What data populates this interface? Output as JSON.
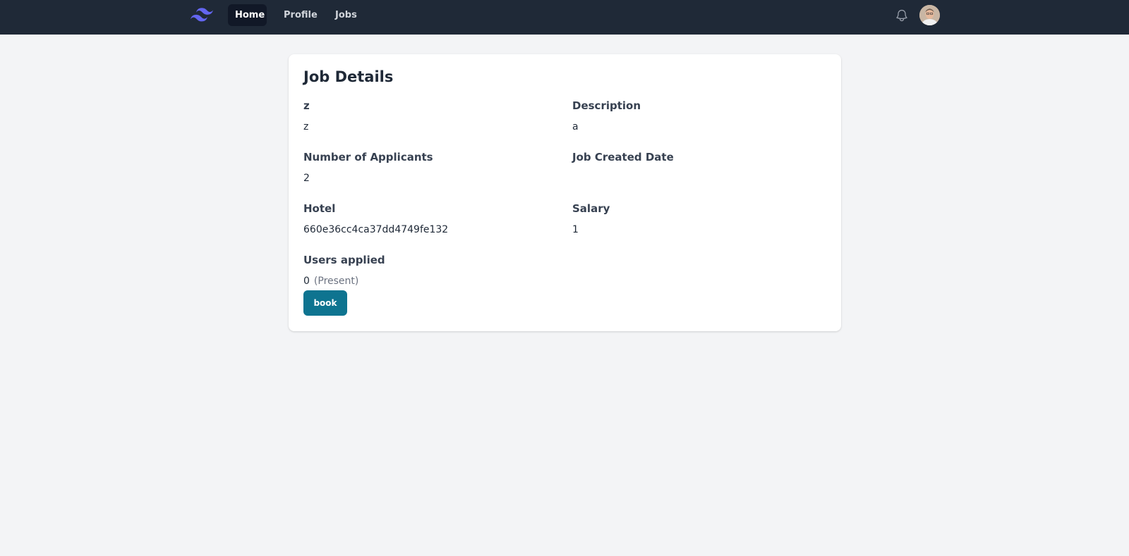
{
  "nav": {
    "logo_icon": "tailwind-wave-logo",
    "links": [
      {
        "label": "Home",
        "active": true
      },
      {
        "label": "Profile",
        "active": false
      },
      {
        "label": "Jobs",
        "active": false
      }
    ],
    "notification_icon": "bell-icon",
    "avatar_icon": "user-avatar"
  },
  "job": {
    "title": "Job Details",
    "fields": {
      "name": {
        "label": "z",
        "value": "z"
      },
      "description": {
        "label": "Description",
        "value": "a"
      },
      "applicants": {
        "label": "Number of Applicants",
        "value": "2"
      },
      "created_date": {
        "label": "Job Created Date",
        "value": ""
      },
      "hotel": {
        "label": "Hotel",
        "value": "660e36cc4ca37dd4749fe132"
      },
      "salary": {
        "label": "Salary",
        "value": "1"
      },
      "users_applied": {
        "label": "Users applied",
        "value": "0",
        "status": "(Present)"
      }
    },
    "book_label": "book"
  },
  "colors": {
    "navbar": "#1f2937",
    "nav_active": "#111827",
    "page_background": "#f3f4f6",
    "card": "#ffffff",
    "button": "#0e7490",
    "logo": "#6366f1"
  }
}
